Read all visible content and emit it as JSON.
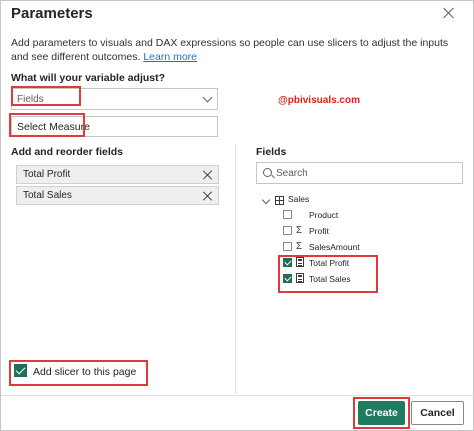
{
  "dialog": {
    "title": "Parameters",
    "description": "Add parameters to visuals and DAX expressions so people can use slicers to adjust the inputs and see different outcomes.",
    "learn_more": "Learn more"
  },
  "variable": {
    "question": "What will your variable adjust?",
    "selected": "Fields"
  },
  "name_input": {
    "value": "Select Measure"
  },
  "watermark": "@pbivisuals.com",
  "add_reorder": {
    "label": "Add and reorder fields",
    "items": [
      {
        "label": "Total Profit"
      },
      {
        "label": "Total Sales"
      }
    ]
  },
  "fields_panel": {
    "label": "Fields",
    "search_placeholder": "Search",
    "table_name": "Sales",
    "items": [
      {
        "label": "Product",
        "icon": "none",
        "checked": false
      },
      {
        "label": "Profit",
        "icon": "sigma-icon",
        "checked": false
      },
      {
        "label": "SalesAmount",
        "icon": "sigma-icon",
        "checked": false
      },
      {
        "label": "Total Profit",
        "icon": "calculator-icon",
        "checked": true
      },
      {
        "label": "Total Sales",
        "icon": "calculator-icon",
        "checked": true
      }
    ]
  },
  "slicer": {
    "label": "Add slicer to this page",
    "checked": true
  },
  "footer": {
    "create_label": "Create",
    "cancel_label": "Cancel"
  },
  "colors": {
    "accent": "#1e7b5f",
    "highlight_box": "#e03a3a",
    "link": "#1a73c8"
  }
}
